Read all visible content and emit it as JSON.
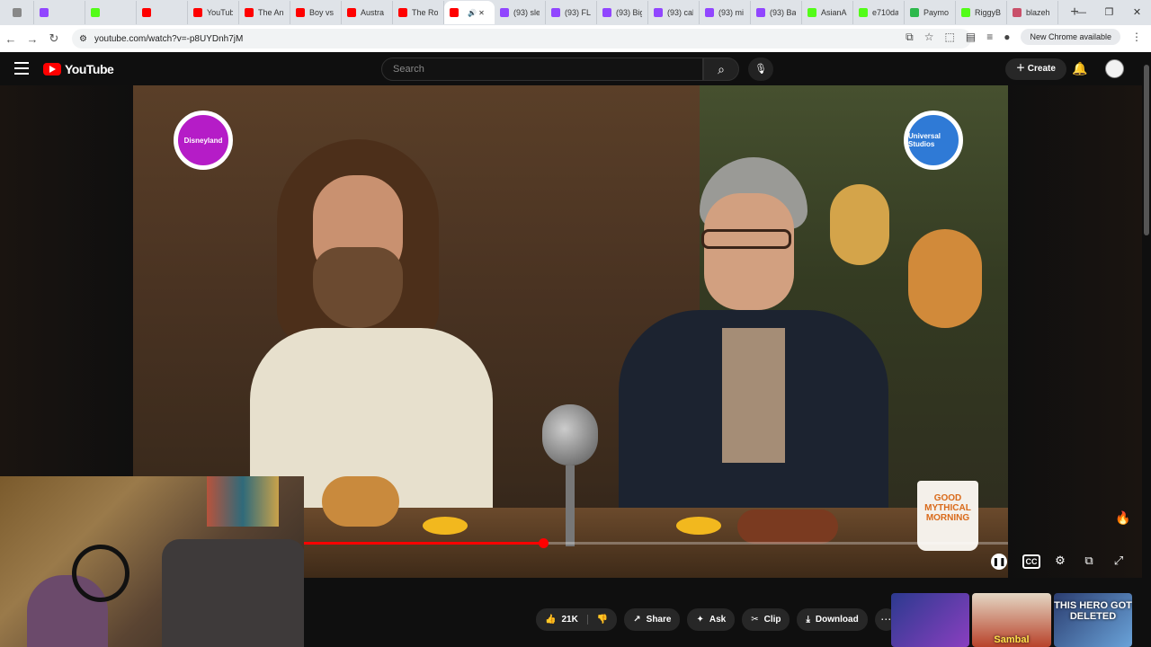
{
  "browser": {
    "tabs": [
      {
        "label": "",
        "color": "#888"
      },
      {
        "label": "",
        "color": "#9146ff"
      },
      {
        "label": "",
        "color": "#53fc18"
      },
      {
        "label": "",
        "color": "#ff0000"
      },
      {
        "label": "YouTub",
        "color": "#ff0000"
      },
      {
        "label": "The An",
        "color": "#ff0000"
      },
      {
        "label": "Boy vs",
        "color": "#ff0000"
      },
      {
        "label": "Austra",
        "color": "#ff0000"
      },
      {
        "label": "The Ro",
        "color": "#ff0000"
      },
      {
        "label": "",
        "color": "#ff0000",
        "active": true
      },
      {
        "label": "(93) sle",
        "color": "#9146ff"
      },
      {
        "label": "(93) FL",
        "color": "#9146ff"
      },
      {
        "label": "(93) Big",
        "color": "#9146ff"
      },
      {
        "label": "(93) cal",
        "color": "#9146ff"
      },
      {
        "label": "(93) mi",
        "color": "#9146ff"
      },
      {
        "label": "(93) Ba",
        "color": "#9146ff"
      },
      {
        "label": "AsianA",
        "color": "#53fc18"
      },
      {
        "label": "e710da",
        "color": "#53fc18"
      },
      {
        "label": "Paymo",
        "color": "#2db84c"
      },
      {
        "label": "RiggyB",
        "color": "#53fc18"
      },
      {
        "label": "blazeh",
        "color": "#c9506a"
      }
    ],
    "url": "youtube.com/watch?v=-p8UYDnh7jM",
    "chrome_available": "New Chrome available"
  },
  "youtube": {
    "logo_text": "YouTube",
    "search_placeholder": "Search",
    "create_label": "Create"
  },
  "video": {
    "mug_text": "GOOD MYTHICAL MORNING",
    "badge_left": "Disneyland",
    "badge_right": "Universal Studios",
    "progress_fraction": 0.34
  },
  "actions": {
    "likes": "21K",
    "share": "Share",
    "ask": "Ask",
    "clip": "Clip",
    "download": "Download"
  },
  "recommendations": [
    {
      "label": ""
    },
    {
      "label": "Sambal"
    },
    {
      "label": "THIS HERO GOT DELETED"
    }
  ],
  "colors": {
    "brand_red": "#ff0000",
    "background": "#0f0f0f"
  }
}
